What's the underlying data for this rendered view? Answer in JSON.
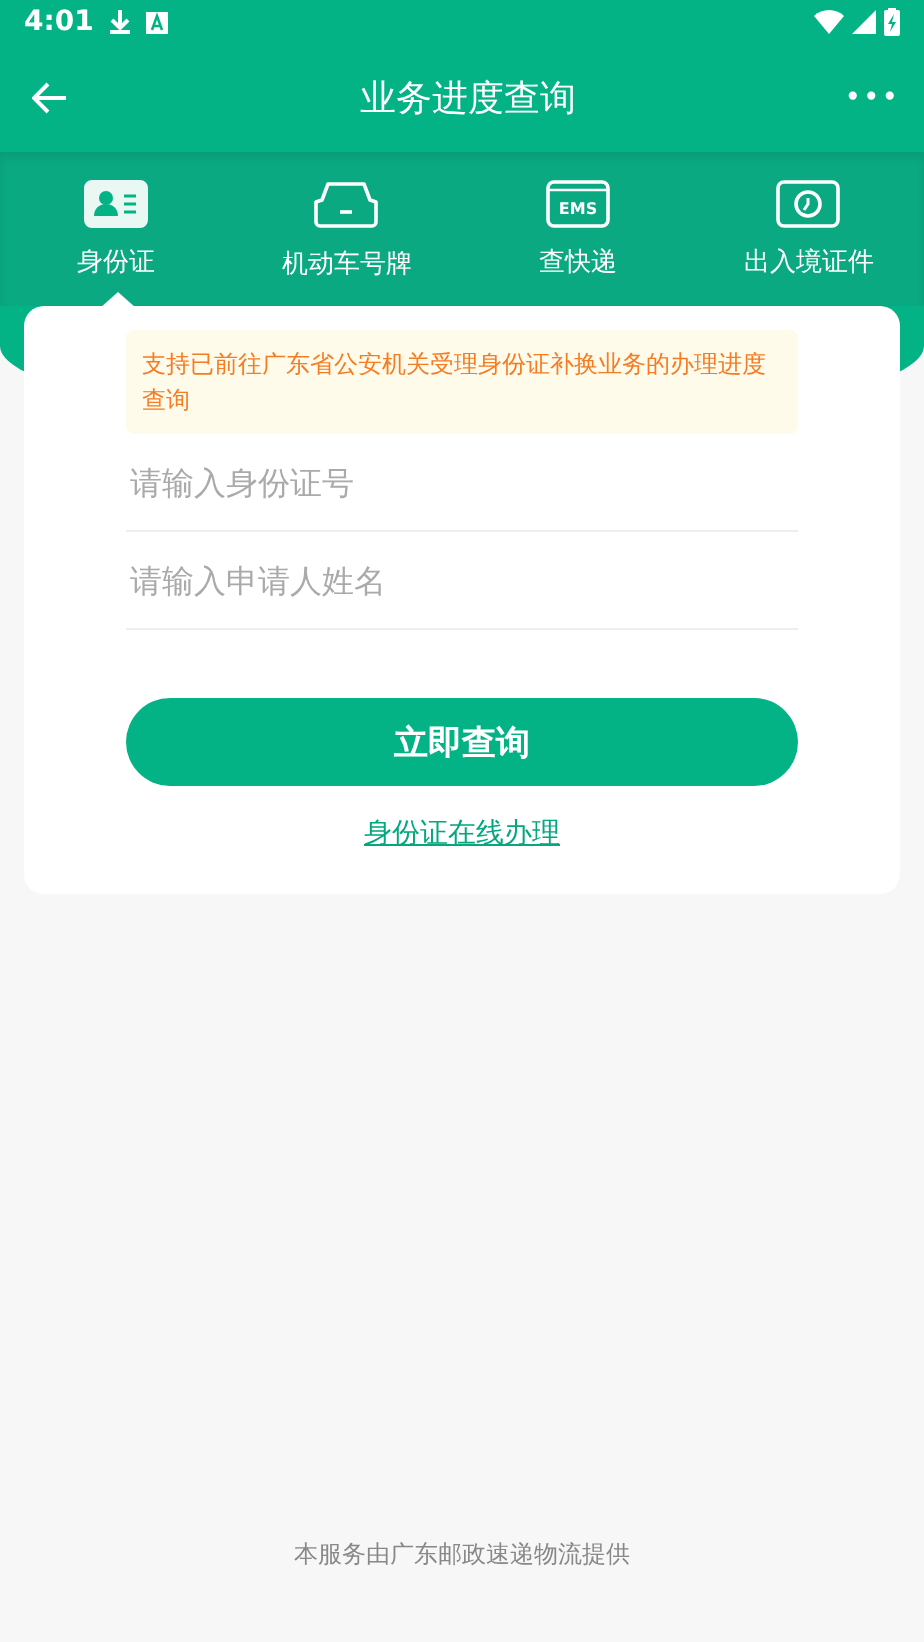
{
  "status_bar": {
    "time": "4:01"
  },
  "header": {
    "title": "业务进度查询",
    "more": "•••"
  },
  "tabs": [
    {
      "label": "身份证",
      "kind": "id-card",
      "selected": true
    },
    {
      "label": "机动车号牌",
      "kind": "car",
      "selected": false
    },
    {
      "label": "查快递",
      "kind": "ems",
      "icon_text": "EMS",
      "selected": false
    },
    {
      "label": "出入境证件",
      "kind": "passport",
      "selected": false
    }
  ],
  "notice": "支持已前往广东省公安机关受理身份证补换业务的办理进度查询",
  "fields": [
    {
      "placeholder": "请输入身份证号"
    },
    {
      "placeholder": "请输入申请人姓名"
    }
  ],
  "submit_button": "立即查询",
  "link": "身份证在线办理",
  "footer": "本服务由广东邮政速递物流提供"
}
